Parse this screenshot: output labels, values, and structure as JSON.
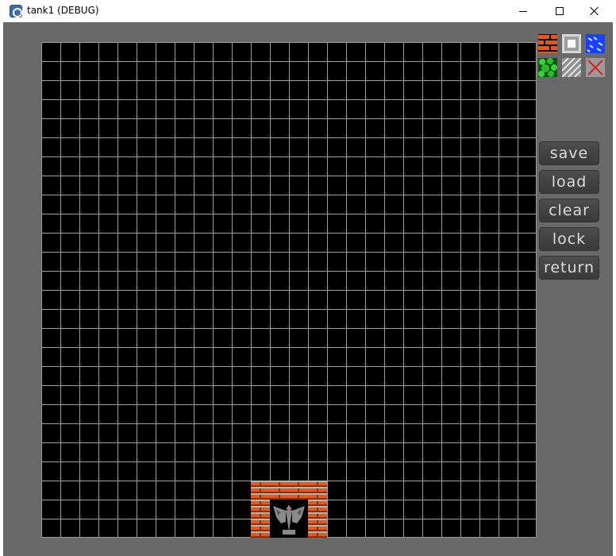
{
  "window": {
    "title": "tank1 (DEBUG)",
    "app_icon": "godot-engine-icon"
  },
  "titlebar_controls": {
    "minimize_icon": "minimize-icon",
    "maximize_icon": "maximize-icon",
    "close_icon": "close-icon"
  },
  "editor": {
    "grid": {
      "columns": 26,
      "rows": 26,
      "background": "#000000",
      "line_color": "#9c9c9c"
    },
    "base_label": "eagle-base-icon",
    "palette": [
      {
        "id": "brick",
        "icon": "brick-wall-icon"
      },
      {
        "id": "steel",
        "icon": "steel-wall-icon"
      },
      {
        "id": "water",
        "icon": "water-icon"
      },
      {
        "id": "forest",
        "icon": "forest-icon"
      },
      {
        "id": "ice",
        "icon": "ice-icon"
      },
      {
        "id": "erase",
        "icon": "erase-icon"
      }
    ],
    "buttons": {
      "save": "save",
      "load": "load",
      "clear": "clear",
      "lock": "lock",
      "return": "return"
    }
  },
  "colors": {
    "panel_background": "#696969",
    "button_background": "#424242",
    "button_text": "#dcdcdc",
    "brick": "#e2581f"
  }
}
